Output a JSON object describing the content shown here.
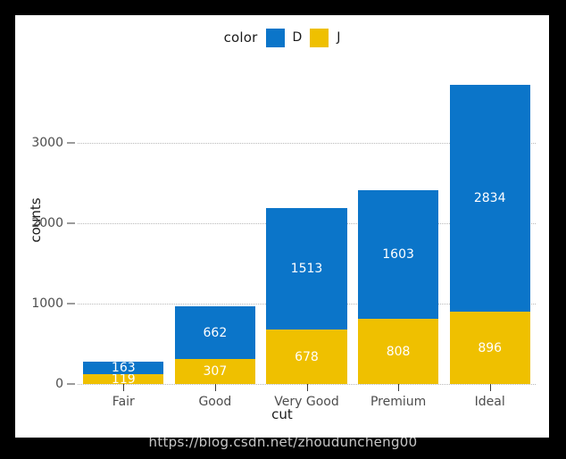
{
  "chart_data": {
    "type": "bar",
    "stacked": true,
    "title": "",
    "xlabel": "cut",
    "ylabel": "counts",
    "categories": [
      "Fair",
      "Good",
      "Very Good",
      "Premium",
      "Ideal"
    ],
    "series": [
      {
        "name": "J",
        "color": "#efc000",
        "values": [
          119,
          307,
          678,
          808,
          896
        ]
      },
      {
        "name": "D",
        "color": "#0b75c9",
        "values": [
          163,
          662,
          1513,
          1603,
          2834
        ]
      }
    ],
    "ylim": [
      0,
      4080
    ],
    "yticks": [
      0,
      1000,
      2000,
      3000
    ],
    "ytick_labels": [
      "0",
      "1000",
      "2000",
      "3000"
    ],
    "grid": true,
    "legend": {
      "title": "color",
      "position": "top",
      "entries": [
        {
          "label": "D",
          "color": "#0b75c9"
        },
        {
          "label": "J",
          "color": "#efc000"
        }
      ]
    }
  },
  "watermark": {
    "text": "https://blog.csdn.net/zhouduncheng00"
  }
}
